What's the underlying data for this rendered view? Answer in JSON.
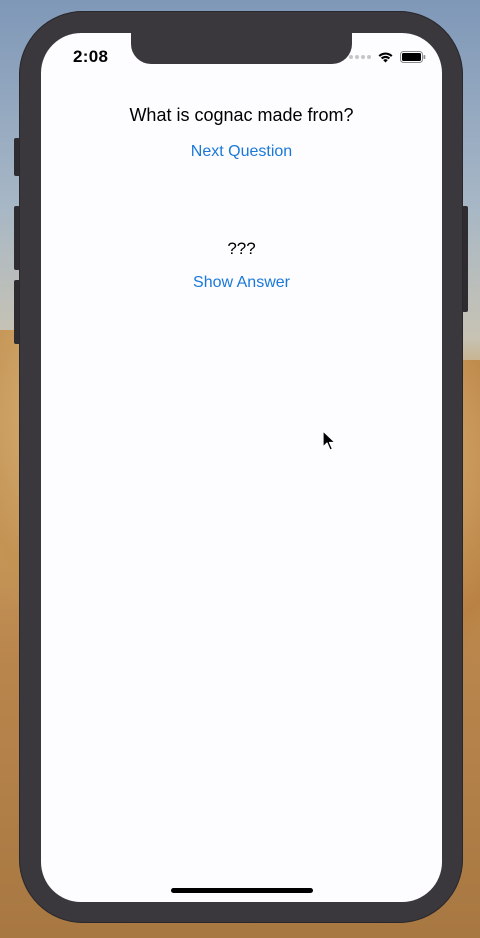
{
  "status_bar": {
    "time": "2:08"
  },
  "quiz": {
    "question": "What is cognac made from?",
    "next_label": "Next Question",
    "answer": "???",
    "show_label": "Show Answer"
  },
  "colors": {
    "accent": "#1a79d8",
    "screen_bg": "#fdfcff",
    "phone_frame": "#3a383c"
  },
  "icons": [
    "wifi-icon",
    "battery-icon",
    "signal-icon",
    "cursor-icon"
  ]
}
